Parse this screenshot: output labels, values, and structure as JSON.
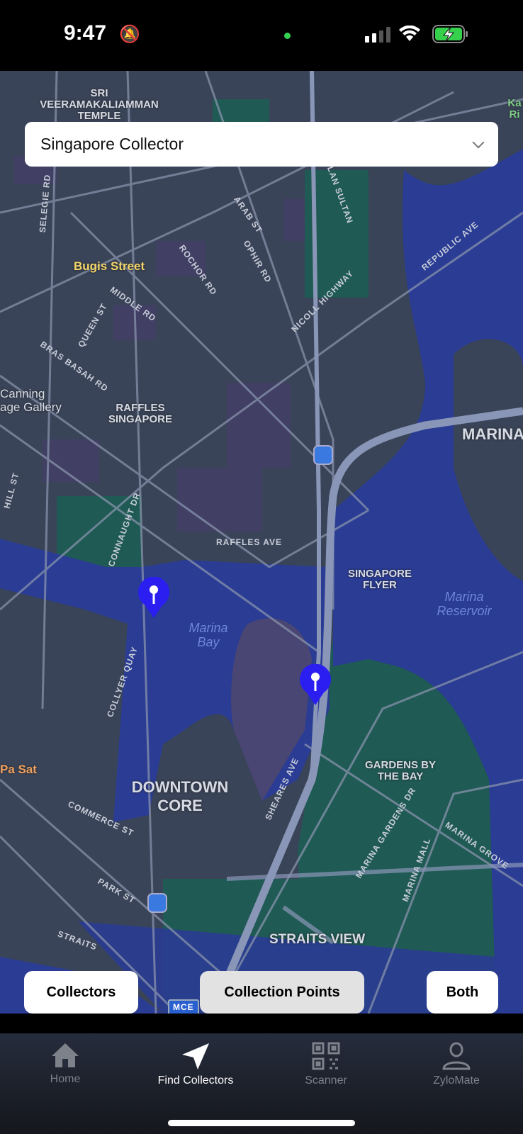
{
  "status_bar": {
    "time": "9:47",
    "silent_icon": "bell-slash-icon",
    "signal_icon": "cellular-icon",
    "wifi_icon": "wifi-icon",
    "battery_icon": "battery-charging-icon"
  },
  "collector_select": {
    "value": "Singapore Collector"
  },
  "map": {
    "labels": [
      "SRI VEERAMAKALIAMMAN TEMPLE",
      "Bugis Street",
      "RAFFLES SINGAPORE",
      "Canning age Gallery",
      "SINGAPORE FLYER",
      "GARDENS BY THE BAY",
      "DOWNTOWN CORE",
      "STRAITS VIEW",
      "MARINA",
      "Pa Sat",
      "Ka Ri"
    ],
    "roads": [
      "ROCHOR RD",
      "OPHIR RD",
      "NICOLL HIGHWAY",
      "REPUBLIC AVE",
      "RAFFLES AVE",
      "BRAS BASAH RD",
      "COLLYER QUAY",
      "SHEARES AVE",
      "MARINA GARDENS DR",
      "COMMERCE ST",
      "PARK ST",
      "ARAB ST",
      "MIDDLE RD",
      "QUEEN ST",
      "SELEGIE RD",
      "CONNAUGHT DR",
      "HILL ST",
      "MARINA GROVE",
      "MARINA MALL",
      "STRAITS",
      "JALAN SULTAN",
      "MCE"
    ],
    "water": [
      "Marina Bay",
      "Marina Reservoir"
    ],
    "pins": [
      {
        "label": "collection-point"
      },
      {
        "label": "collection-point"
      }
    ],
    "colors": {
      "land": "#3a4458",
      "water": "#2a3c94",
      "park": "#1f5a54",
      "road": "#8792ab",
      "pin": "#2a1ff0"
    }
  },
  "filters": [
    {
      "label": "Collectors",
      "selected": false
    },
    {
      "label": "Collection Points",
      "selected": true
    },
    {
      "label": "Both",
      "selected": false
    }
  ],
  "tabs": [
    {
      "label": "Home",
      "icon": "home-icon"
    },
    {
      "label": "Find Collectors",
      "icon": "paper-plane-icon",
      "active": true
    },
    {
      "label": "Scanner",
      "icon": "qr-code-icon"
    },
    {
      "label": "ZyloMate",
      "icon": "person-icon"
    }
  ]
}
